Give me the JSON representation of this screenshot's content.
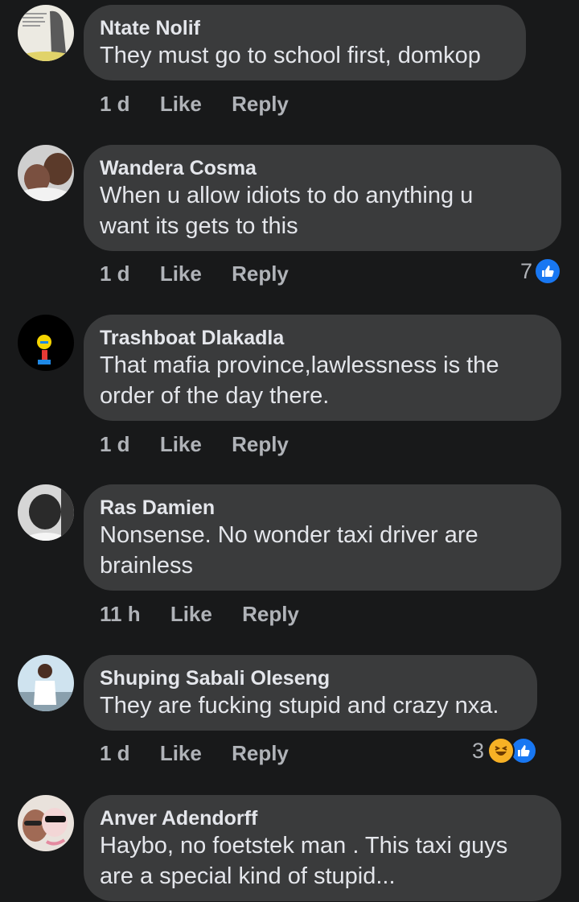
{
  "comments": [
    {
      "author": "Ntate Nolif",
      "lines": [
        "They must go to school first, domkop"
      ],
      "time": "1 d",
      "like": "Like",
      "reply": "Reply",
      "reaction_count": "",
      "avatar_colors": [
        "#f0ede4",
        "#d8cfa8"
      ]
    },
    {
      "author": "Wandera Cosma",
      "lines": [
        "When u allow idiots to do anything u",
        "want its gets to this"
      ],
      "time": "1 d",
      "like": "Like",
      "reply": "Reply",
      "reaction_count": "7",
      "avatar_colors": [
        "#6b4a3a",
        "#dcdcdc"
      ]
    },
    {
      "author": "Trashboat Dlakadla",
      "lines": [
        "That mafia province,lawlessness is the",
        "order of the day there."
      ],
      "time": "1 d",
      "like": "Like",
      "reply": "Reply",
      "reaction_count": "",
      "avatar_colors": [
        "#000000",
        "#f5d400"
      ]
    },
    {
      "author": "Ras Damien",
      "lines": [
        "Nonsense. No wonder taxi driver are",
        "brainless"
      ],
      "time": "11 h",
      "like": "Like",
      "reply": "Reply",
      "reaction_count": "",
      "avatar_colors": [
        "#2a2a2a",
        "#bdbdbd"
      ]
    },
    {
      "author": "Shuping Sabali Oleseng",
      "lines": [
        "They are fucking stupid and crazy nxa."
      ],
      "time": "1 d",
      "like": "Like",
      "reply": "Reply",
      "reaction_count": "3",
      "avatar_colors": [
        "#cfe0ea",
        "#ffffff"
      ]
    },
    {
      "author": "Anver Adendorff",
      "lines": [
        "Haybo,  no foetstek man . This taxi guys",
        "are a special kind of stupid..."
      ],
      "time": "",
      "like": "",
      "reply": "",
      "reaction_count": "",
      "avatar_colors": [
        "#b08070",
        "#f2c1c9"
      ]
    }
  ]
}
